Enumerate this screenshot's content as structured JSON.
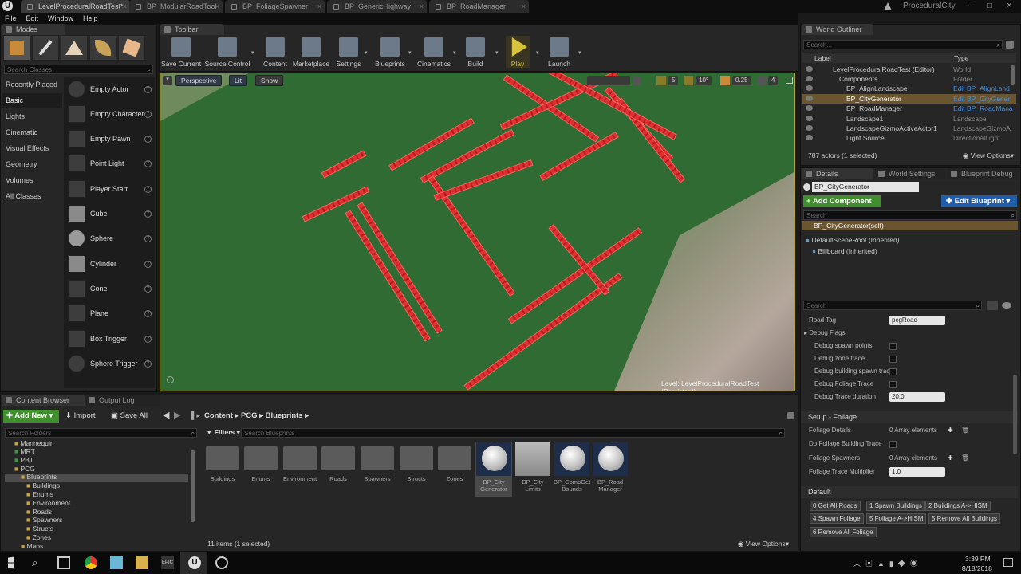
{
  "doc_tabs": [
    "LevelProceduralRoadTest*",
    "BP_ModularRoadTool",
    "BP_FoliageSpawner",
    "BP_GenericHighway",
    "BP_RoadManager"
  ],
  "project_name": "ProceduralCity",
  "menu": [
    "File",
    "Edit",
    "Window",
    "Help"
  ],
  "modes": {
    "tab_label": "Modes",
    "search_placeholder": "Search Classes",
    "categories": [
      "Recently Placed",
      "Basic",
      "Lights",
      "Cinematic",
      "Visual Effects",
      "Geometry",
      "Volumes",
      "All Classes"
    ],
    "selected_category": "Basic",
    "actors": [
      "Empty Actor",
      "Empty Character",
      "Empty Pawn",
      "Point Light",
      "Player Start",
      "Cube",
      "Sphere",
      "Cylinder",
      "Cone",
      "Plane",
      "Box Trigger",
      "Sphere Trigger"
    ]
  },
  "toolbar": {
    "tab_label": "Toolbar",
    "items": [
      "Save Current",
      "Source Control",
      "Content",
      "Marketplace",
      "Settings",
      "Blueprints",
      "Cinematics",
      "Build",
      "Play",
      "Launch"
    ]
  },
  "viewport": {
    "perspective": "Perspective",
    "lit": "Lit",
    "show": "Show",
    "grid_snap": "5",
    "rot_snap": "10°",
    "scale_snap": "0.25",
    "camera_speed": "4",
    "level_label": "Level:",
    "level_name": "LevelProceduralRoadTest (Persistent)"
  },
  "outliner": {
    "tab_label": "World Outliner",
    "search_placeholder": "Search...",
    "col_label": "Label",
    "col_type": "Type",
    "rows": [
      {
        "name": "LevelProceduralRoadTest (Editor)",
        "type": "World"
      },
      {
        "name": "Components",
        "type": "Folder"
      },
      {
        "name": "BP_AlignLandscape",
        "type": "Edit BP_AlignLand"
      },
      {
        "name": "BP_CityGenerator",
        "type": "Edit BP_CityGener"
      },
      {
        "name": "BP_RoadManager",
        "type": "Edit BP_RoadMana"
      },
      {
        "name": "Landscape1",
        "type": "Landscape"
      },
      {
        "name": "LandscapeGizmoActiveActor1",
        "type": "LandscapeGizmoA"
      },
      {
        "name": "Light Source",
        "type": "DirectionalLight"
      }
    ],
    "count": "787 actors (1 selected)",
    "view_options": "View Options"
  },
  "details": {
    "tabs": [
      "Details",
      "World Settings",
      "Blueprint Debug"
    ],
    "object_name": "BP_CityGenerator",
    "add_component": "+ Add Component",
    "edit_blueprint": "Edit Blueprint",
    "search_placeholder": "Search",
    "self_label": "BP_CityGenerator(self)",
    "tree": [
      "DefaultSceneRoot (Inherited)",
      "Billboard (Inherited)"
    ],
    "search2_placeholder": "Search",
    "road_tag_label": "Road Tag",
    "road_tag_value": "pcgRoad",
    "debug_flags": "Debug Flags",
    "debug_props": [
      "Debug spawn points",
      "Debug zone trace",
      "Debug building spawn trace",
      "Debug Foliage Trace"
    ],
    "debug_trace_label": "Debug Trace duration",
    "debug_trace_value": "20.0",
    "setup_foliage": "Setup - Foliage",
    "foliage_details": "Foliage Details",
    "foliage_details_value": "0 Array elements",
    "do_foliage_trace": "Do Foliage Building Trace",
    "foliage_spawners": "Foliage Spawners",
    "foliage_spawners_value": "0 Array elements",
    "foliage_mult_label": "Foliage Trace Multiplier",
    "foliage_mult_value": "1.0",
    "default_section": "Default",
    "default_buttons": [
      "0 Get All Roads",
      "1 Spawn Buildings",
      "2 Buildings A->HISM",
      "4 Spawn Foliage",
      "5 Foliage A->HISM",
      "5 Remove All Buildings",
      "6 Remove All Foliage"
    ]
  },
  "content_browser": {
    "tabs": [
      "Content Browser",
      "Output Log"
    ],
    "add_new": "Add New",
    "import": "Import",
    "save_all": "Save All",
    "path": [
      "Content",
      "PCG",
      "Blueprints"
    ],
    "search_folders": "Search Folders",
    "filters": "Filters",
    "search_blueprints": "Search Blueprints",
    "tree": [
      "Mannequin",
      "MRT",
      "PBT",
      "PCG",
      "Blueprints",
      "Buildings",
      "Enums",
      "Environment",
      "Roads",
      "Spawners",
      "Structs",
      "Zones",
      "Maps"
    ],
    "folders": [
      "Buildings",
      "Enums",
      "Environment",
      "Roads",
      "Spawners",
      "Structs",
      "Zones"
    ],
    "assets": [
      "BP_City Generator",
      "BP_City Limits",
      "BP_CompGet Bounds",
      "BP_Road Manager"
    ],
    "status": "11 items (1 selected)",
    "view_options": "View Options"
  },
  "taskbar": {
    "time": "3:39 PM",
    "date": "8/18/2018"
  },
  "colors": {
    "accent_play": "#d7c23c",
    "selection": "#6a5530",
    "add_green": "#3f8f2c",
    "edit_blue": "#1f5ea8",
    "road_red": "#e03030",
    "ground_green": "#2f6b33"
  }
}
